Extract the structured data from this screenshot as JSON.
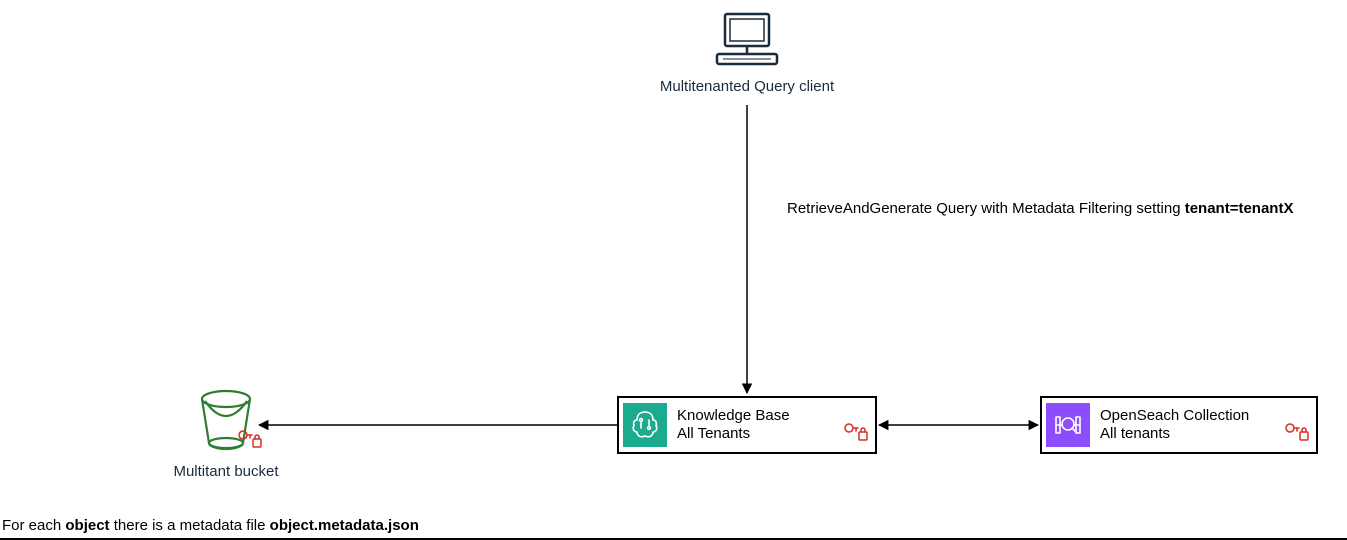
{
  "client": {
    "label": "Multitenanted Query client"
  },
  "edge1": {
    "prefix": "RetrieveAndGenerate Query with Metadata Filtering setting ",
    "bold": "tenant=tenantX"
  },
  "kb": {
    "title": "Knowledge Base",
    "subtitle": "All Tenants"
  },
  "os": {
    "title": "OpenSeach Collection",
    "subtitle": "All tenants"
  },
  "bucket": {
    "label": "Multitant bucket"
  },
  "footnote": {
    "p1": "For each ",
    "b1": "object",
    "p2": " there is a metadata file ",
    "b2": "object.metadata.json"
  }
}
